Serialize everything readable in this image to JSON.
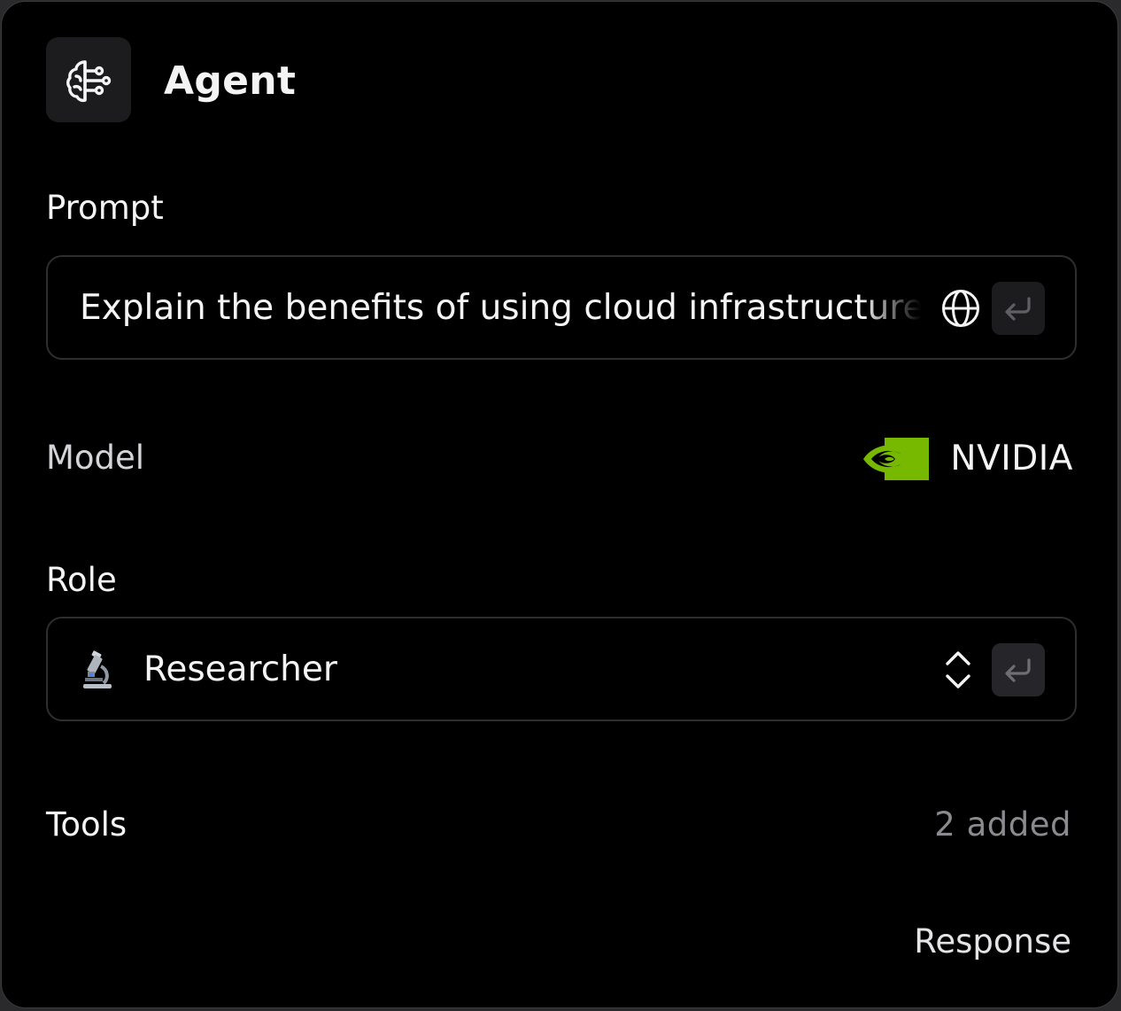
{
  "header": {
    "title": "Agent",
    "icon": "brain-icon"
  },
  "prompt": {
    "label": "Prompt",
    "value": "Explain the benefits of using cloud infrastructure for startups",
    "icons": [
      "globe-icon",
      "enter-icon"
    ]
  },
  "model": {
    "label": "Model",
    "value": "NVIDIA",
    "logo": "nvidia-logo",
    "brand_color": "#76b900"
  },
  "role": {
    "label": "Role",
    "emoji": "microscope-icon",
    "value": "Researcher",
    "icons": [
      "chevron-up-down-icon",
      "enter-icon"
    ]
  },
  "tools": {
    "label": "Tools",
    "count_text": "2 added"
  },
  "footer": {
    "response_label": "Response"
  },
  "colors": {
    "background": "#000000",
    "text": "#f4f4f5",
    "muted_text": "#8a8a8f",
    "border": "#2e2e31",
    "surface": "#1c1c1e"
  }
}
